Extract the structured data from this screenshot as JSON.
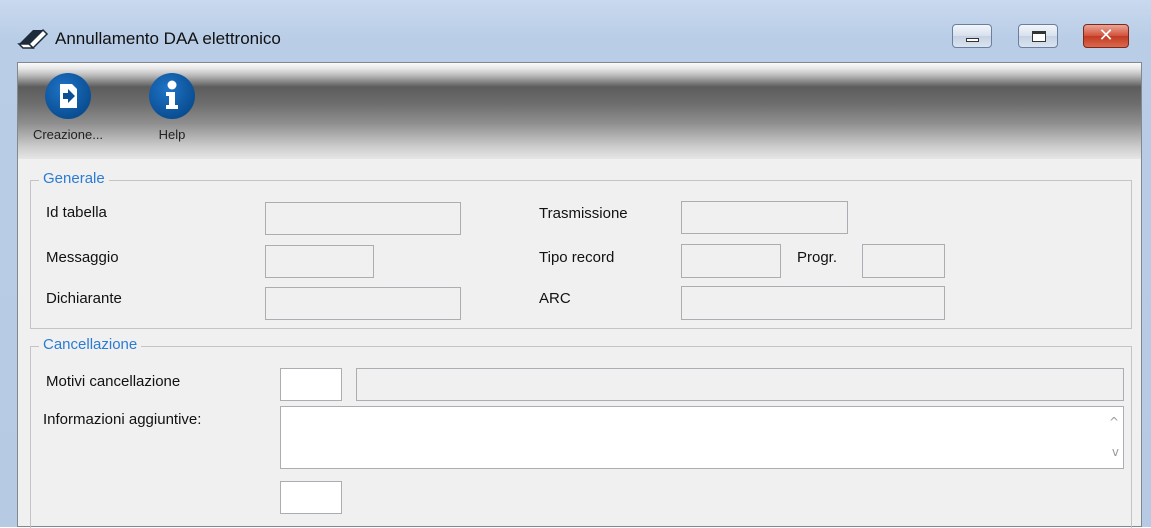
{
  "window": {
    "title": "Annullamento DAA elettronico",
    "close_glyph": "✕"
  },
  "toolbar": {
    "create_label": "Creazione...",
    "help_label": "Help"
  },
  "generale": {
    "legend": "Generale",
    "id_tabella_label": "Id tabella",
    "messaggio_label": "Messaggio",
    "dichiarante_label": "Dichiarante",
    "trasmissione_label": "Trasmissione",
    "tipo_record_label": "Tipo record",
    "progr_label": "Progr.",
    "arc_label": "ARC",
    "id_tabella_value": "",
    "messaggio_value": "",
    "dichiarante_value": "",
    "trasmissione_value": "",
    "tipo_record_value": "",
    "progr_value": "",
    "arc_value": ""
  },
  "cancellazione": {
    "legend": "Cancellazione",
    "motivi_label": "Motivi cancellazione",
    "info_label": "Informazioni aggiuntive:",
    "motivi_code_value": "",
    "motivi_desc_value": "",
    "info_value": "",
    "extra_value": ""
  },
  "icons": {
    "create": "document-arrow-icon",
    "help": "info-icon",
    "title": "eraser-icon"
  },
  "colors": {
    "legend": "#2b7cd3",
    "toolbar_icon": "#0a4f94",
    "close_button": "#c23a21"
  }
}
